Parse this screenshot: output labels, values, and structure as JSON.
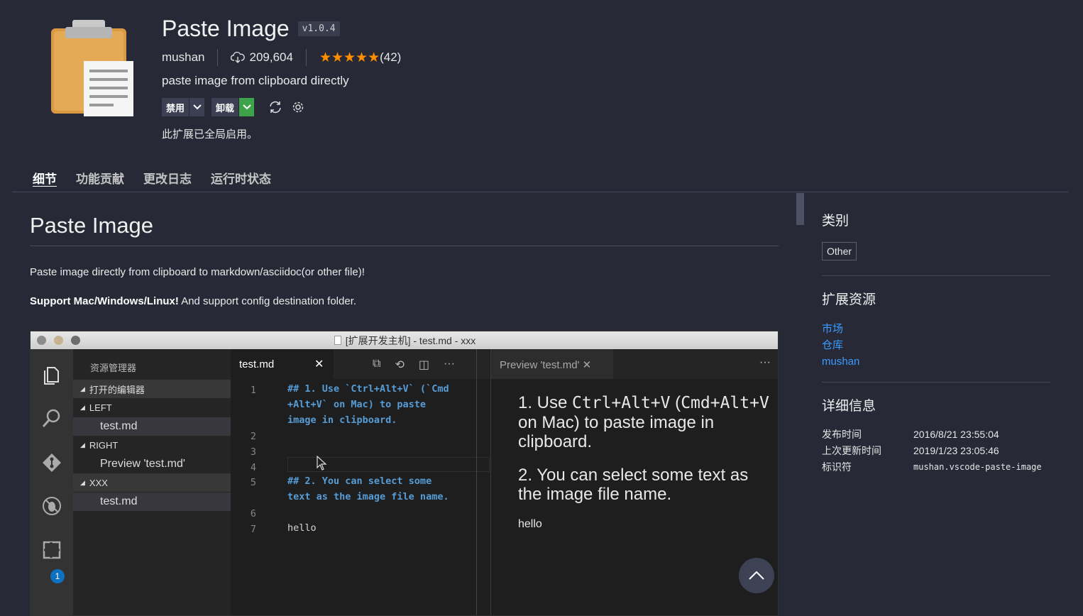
{
  "header": {
    "name": "Paste Image",
    "version": "v1.0.4",
    "publisher": "mushan",
    "installs": "209,604",
    "stars": "★★★★★",
    "rating": 5,
    "rating_count": "(42)",
    "description": "paste image from clipboard directly",
    "disable_label": "禁用",
    "uninstall_label": "卸载",
    "status": "此扩展已全局启用。"
  },
  "tabs": [
    "细节",
    "功能贡献",
    "更改日志",
    "运行时状态"
  ],
  "readme": {
    "title": "Paste Image",
    "p1": "Paste image directly from clipboard to markdown/asciidoc(or other file)!",
    "p2_bold": "Support Mac/Windows/Linux!",
    "p2_rest": " And support config destination folder."
  },
  "screenshot": {
    "window_title": "[扩展开发主机] - test.md - xxx",
    "explorer_title": "资源管理器",
    "sections": {
      "open_editors": "打开的编辑器",
      "left": "LEFT",
      "left_item": "test.md",
      "right": "RIGHT",
      "right_item": "Preview 'test.md'",
      "folder": "XXX",
      "folder_item": "test.md"
    },
    "badge": "1",
    "editor_tab": "test.md",
    "preview_tab": "Preview 'test.md'",
    "line_numbers": [
      "1",
      "2",
      "3",
      "4",
      "5",
      "6",
      "7"
    ],
    "code": {
      "l1a": "## 1. Use `Ctrl+Alt+V` (`Cmd",
      "l1b": "+Alt+V` on Mac) to paste",
      "l1c": "image in clipboard.",
      "l5a": "## 2. You can select some",
      "l5b": "text as the image file name.",
      "l7": "hello"
    },
    "preview": {
      "p1_pre": "1. Use ",
      "p1_code1": "Ctrl+Alt+V",
      "p1_mid": " (",
      "p1_code2": "Cmd+Alt+V",
      "p1_post": " on Mac) to paste image in clipboard.",
      "p2": "2. You can select some text as the image file name.",
      "hello": "hello"
    }
  },
  "sidebar": {
    "category_heading": "类别",
    "category": "Other",
    "resources_heading": "扩展资源",
    "links": [
      "市场",
      "仓库",
      "mushan"
    ],
    "details_heading": "详细信息",
    "details": [
      {
        "key": "发布时间",
        "value": "2016/8/21 23:55:04"
      },
      {
        "key": "上次更新时间",
        "value": "2019/1/23 23:05:46"
      },
      {
        "key": "标识符",
        "value": "mushan.vscode-paste-image"
      }
    ]
  },
  "colors": {
    "background": "#272937",
    "star": "#ff8e00",
    "link": "#3b9bff",
    "uninstall_accent": "#3da34a"
  }
}
